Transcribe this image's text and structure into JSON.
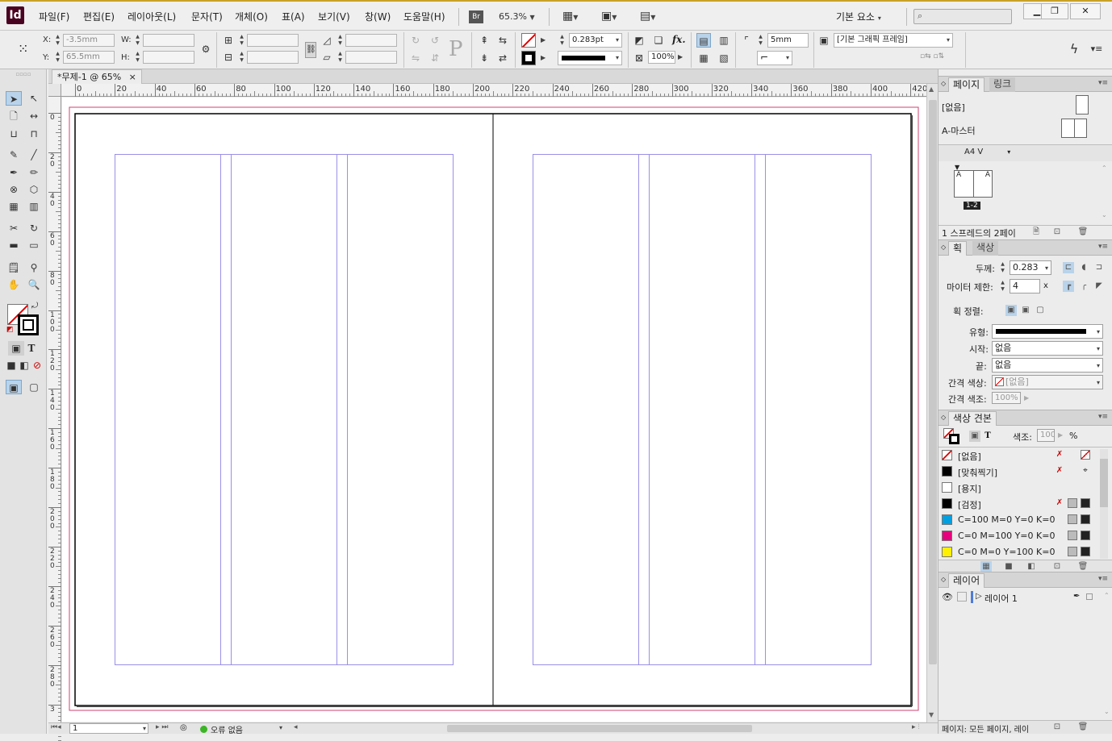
{
  "app": {
    "logo": "Id"
  },
  "menu": [
    "파일(F)",
    "편집(E)",
    "레이아웃(L)",
    "문자(T)",
    "개체(O)",
    "표(A)",
    "보기(V)",
    "창(W)",
    "도움말(H)"
  ],
  "menubar": {
    "bridge_label": "Br",
    "zoom": "65.3%",
    "workspace": "기본 요소"
  },
  "window_buttons": {
    "minimize": "▁",
    "restore": "❐",
    "close": "✕"
  },
  "control": {
    "x_label": "X:",
    "x_value": "-3.5mm",
    "y_label": "Y:",
    "y_value": "65.5mm",
    "w_label": "W:",
    "h_label": "H:",
    "stroke_weight": "0.283pt",
    "opacity": "100%",
    "fx_label": "fx.",
    "offset_value": "5mm",
    "object_style": "[기본 그래픽 프레임]",
    "p_icon": "P"
  },
  "doc_tab": {
    "title": "*무제-1 @ 65%",
    "close": "×"
  },
  "ruler": {
    "h_ticks": [
      "0",
      "20",
      "40",
      "60",
      "80",
      "100",
      "120",
      "140",
      "160",
      "180",
      "200",
      "220",
      "240",
      "260",
      "280",
      "300",
      "320",
      "340",
      "360",
      "380",
      "400",
      "420"
    ],
    "v_ticks": [
      "0",
      "2\n0",
      "4\n0",
      "6\n0",
      "8\n0",
      "1\n0\n0",
      "1\n2\n0",
      "1\n4\n0",
      "1\n6\n0",
      "1\n8\n0",
      "2\n0\n0",
      "2\n2\n0",
      "2\n4\n0",
      "2\n6\n0",
      "2\n8\n0",
      "3"
    ]
  },
  "status": {
    "page": "1",
    "preflight": "오류 없음"
  },
  "pages_panel": {
    "tab_pages": "페이지",
    "tab_links": "링크",
    "none_label": "[없음]",
    "master_label": "A-마스터",
    "size_label": "A4 V",
    "spread_letter_left": "A",
    "spread_letter_right": "A",
    "spread_number": "1-2",
    "footer": "1 스프레드의 2페이"
  },
  "stroke_panel": {
    "tab_stroke": "획",
    "tab_color": "색상",
    "weight_label": "두께:",
    "weight_value": "0.283",
    "miter_label": "마이터 제한:",
    "miter_value": "4",
    "miter_unit": "x",
    "align_label": "획 정렬:",
    "type_label": "유형:",
    "start_label": "시작:",
    "start_value": "없음",
    "end_label": "끝:",
    "end_value": "없음",
    "gap_color_label": "간격 색상:",
    "gap_color_value": "[없음]",
    "gap_tint_label": "간격 색조:",
    "gap_tint_value": "100%"
  },
  "swatches_panel": {
    "tab": "색상 견본",
    "tint_label": "색조:",
    "tint_value": "100",
    "tint_unit": "%",
    "text_icon": "T",
    "items": [
      {
        "name": "[없음]",
        "color": "none"
      },
      {
        "name": "[맞춰찍기]",
        "color": "#000000"
      },
      {
        "name": "[용지]",
        "color": "#ffffff"
      },
      {
        "name": "[검정]",
        "color": "#000000"
      },
      {
        "name": "C=100 M=0 Y=0 K=0",
        "color": "#00a0e0"
      },
      {
        "name": "C=0 M=100 Y=0 K=0",
        "color": "#e6007e"
      },
      {
        "name": "C=0 M=0 Y=100 K=0",
        "color": "#fff000"
      }
    ]
  },
  "layers_panel": {
    "tab": "레이어",
    "layer_name": "레이어 1",
    "footer": "페이지: 모든 페이지, 레이"
  },
  "colors": {
    "margin": "#d04070",
    "column_guide": "#9b8fe6",
    "accent": "#b9d3ea"
  }
}
